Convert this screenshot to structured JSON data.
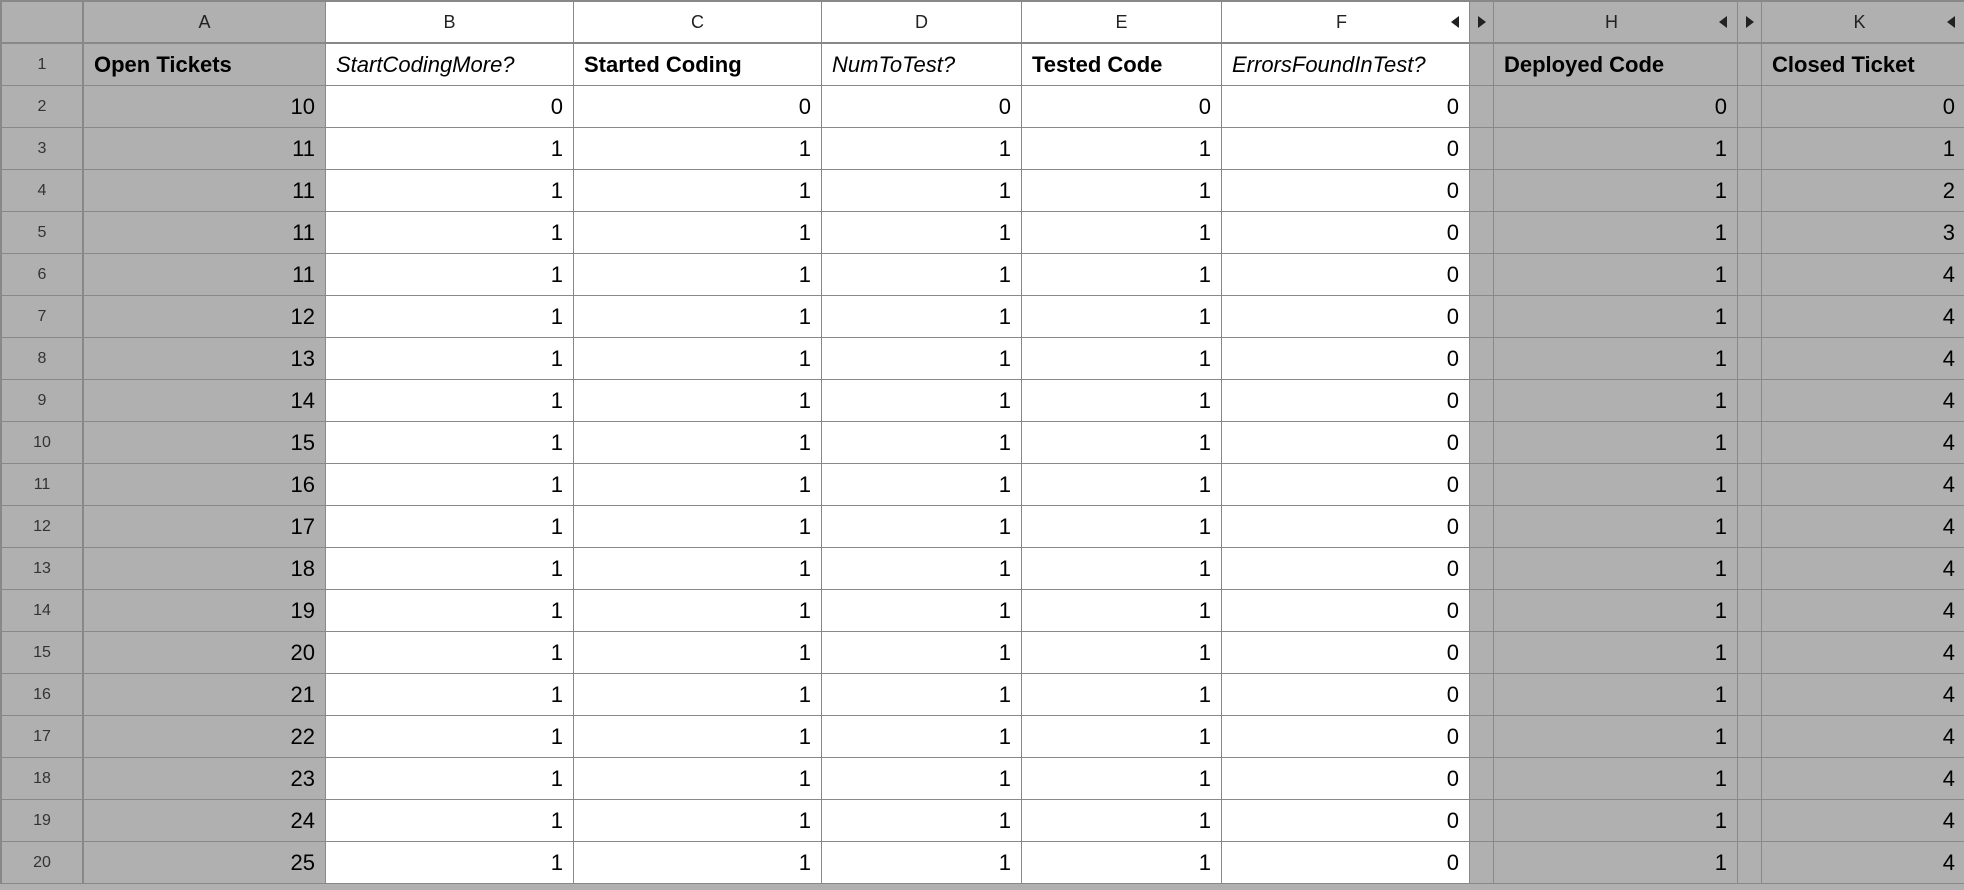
{
  "columns": {
    "A": "A",
    "B": "B",
    "C": "C",
    "D": "D",
    "E": "E",
    "F": "F",
    "H": "H",
    "K": "K"
  },
  "row_numbers": [
    "1",
    "2",
    "3",
    "4",
    "5",
    "6",
    "7",
    "8",
    "9",
    "10",
    "11",
    "12",
    "13",
    "14",
    "15",
    "16",
    "17",
    "18",
    "19",
    "20"
  ],
  "headers": {
    "A": "Open Tickets",
    "B": "StartCodingMore?",
    "C": "Started Coding",
    "D": "NumToTest?",
    "E": "Tested Code",
    "F": "ErrorsFoundInTest?",
    "H": "Deployed Code",
    "K": "Closed Ticket"
  },
  "chart_data": {
    "type": "table",
    "columns": [
      "Open Tickets",
      "StartCodingMore?",
      "Started Coding",
      "NumToTest?",
      "Tested Code",
      "ErrorsFoundInTest?",
      "Deployed Code",
      "Closed Ticket"
    ],
    "rows": [
      [
        10,
        0,
        0,
        0,
        0,
        0,
        0,
        0
      ],
      [
        11,
        1,
        1,
        1,
        1,
        0,
        1,
        1
      ],
      [
        11,
        1,
        1,
        1,
        1,
        0,
        1,
        2
      ],
      [
        11,
        1,
        1,
        1,
        1,
        0,
        1,
        3
      ],
      [
        11,
        1,
        1,
        1,
        1,
        0,
        1,
        4
      ],
      [
        12,
        1,
        1,
        1,
        1,
        0,
        1,
        4
      ],
      [
        13,
        1,
        1,
        1,
        1,
        0,
        1,
        4
      ],
      [
        14,
        1,
        1,
        1,
        1,
        0,
        1,
        4
      ],
      [
        15,
        1,
        1,
        1,
        1,
        0,
        1,
        4
      ],
      [
        16,
        1,
        1,
        1,
        1,
        0,
        1,
        4
      ],
      [
        17,
        1,
        1,
        1,
        1,
        0,
        1,
        4
      ],
      [
        18,
        1,
        1,
        1,
        1,
        0,
        1,
        4
      ],
      [
        19,
        1,
        1,
        1,
        1,
        0,
        1,
        4
      ],
      [
        20,
        1,
        1,
        1,
        1,
        0,
        1,
        4
      ],
      [
        21,
        1,
        1,
        1,
        1,
        0,
        1,
        4
      ],
      [
        22,
        1,
        1,
        1,
        1,
        0,
        1,
        4
      ],
      [
        23,
        1,
        1,
        1,
        1,
        0,
        1,
        4
      ],
      [
        24,
        1,
        1,
        1,
        1,
        0,
        1,
        4
      ],
      [
        25,
        1,
        1,
        1,
        1,
        0,
        1,
        4
      ]
    ]
  }
}
